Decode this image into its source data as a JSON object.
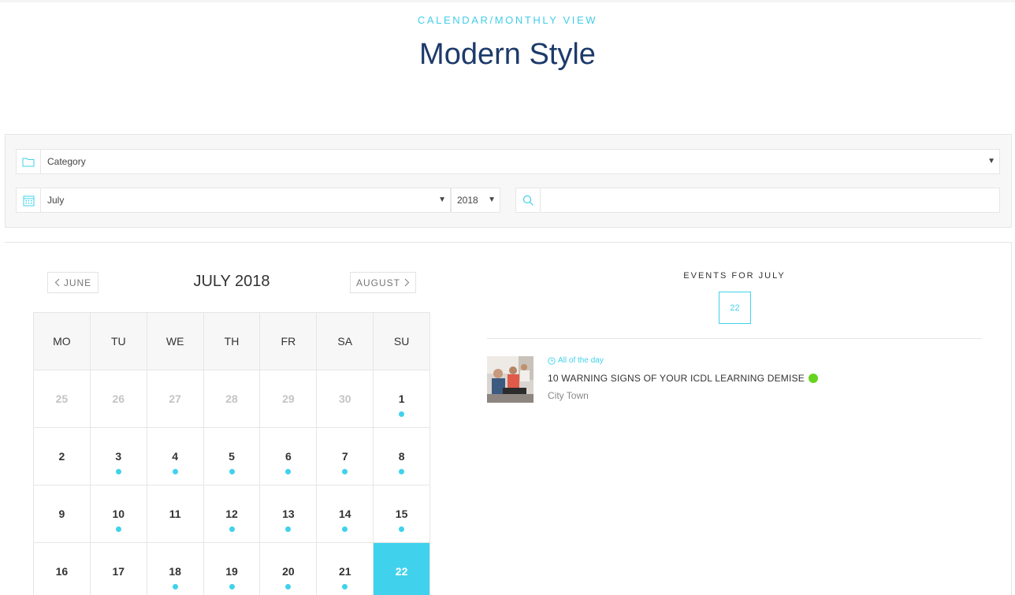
{
  "header": {
    "subtitle": "CALENDAR/MONTHLY VIEW",
    "title": "Modern Style"
  },
  "filters": {
    "category": {
      "value": "Category"
    },
    "month": {
      "value": "July"
    },
    "year": {
      "value": "2018"
    },
    "search": {
      "placeholder": ""
    }
  },
  "calendar": {
    "prev_label": "JUNE",
    "next_label": "AUGUST",
    "month_title": "JULY 2018",
    "weekdays": [
      "MO",
      "TU",
      "WE",
      "TH",
      "FR",
      "SA",
      "SU"
    ],
    "weeks": [
      [
        {
          "day": "25",
          "muted": true,
          "event": false
        },
        {
          "day": "26",
          "muted": true,
          "event": false
        },
        {
          "day": "27",
          "muted": true,
          "event": false
        },
        {
          "day": "28",
          "muted": true,
          "event": false
        },
        {
          "day": "29",
          "muted": true,
          "event": false
        },
        {
          "day": "30",
          "muted": true,
          "event": false
        },
        {
          "day": "1",
          "muted": false,
          "event": true
        }
      ],
      [
        {
          "day": "2",
          "muted": false,
          "event": false
        },
        {
          "day": "3",
          "muted": false,
          "event": true
        },
        {
          "day": "4",
          "muted": false,
          "event": true
        },
        {
          "day": "5",
          "muted": false,
          "event": true
        },
        {
          "day": "6",
          "muted": false,
          "event": true
        },
        {
          "day": "7",
          "muted": false,
          "event": true
        },
        {
          "day": "8",
          "muted": false,
          "event": true
        }
      ],
      [
        {
          "day": "9",
          "muted": false,
          "event": false
        },
        {
          "day": "10",
          "muted": false,
          "event": true
        },
        {
          "day": "11",
          "muted": false,
          "event": false
        },
        {
          "day": "12",
          "muted": false,
          "event": true
        },
        {
          "day": "13",
          "muted": false,
          "event": true
        },
        {
          "day": "14",
          "muted": false,
          "event": true
        },
        {
          "day": "15",
          "muted": false,
          "event": true
        }
      ],
      [
        {
          "day": "16",
          "muted": false,
          "event": false
        },
        {
          "day": "17",
          "muted": false,
          "event": false
        },
        {
          "day": "18",
          "muted": false,
          "event": true
        },
        {
          "day": "19",
          "muted": false,
          "event": true
        },
        {
          "day": "20",
          "muted": false,
          "event": true
        },
        {
          "day": "21",
          "muted": false,
          "event": true
        },
        {
          "day": "22",
          "muted": false,
          "event": false,
          "selected": true
        }
      ]
    ]
  },
  "events": {
    "heading": "EVENTS FOR JULY",
    "selected_day": "22",
    "items": [
      {
        "time": "All of the day",
        "title": "10 WARNING SIGNS OF YOUR ICDL LEARNING DEMISE",
        "location": "City Town",
        "status_color": "#66d41d"
      }
    ]
  },
  "colors": {
    "accent": "#40d2ec",
    "title": "#1d3a6a",
    "status_green": "#66d41d"
  }
}
